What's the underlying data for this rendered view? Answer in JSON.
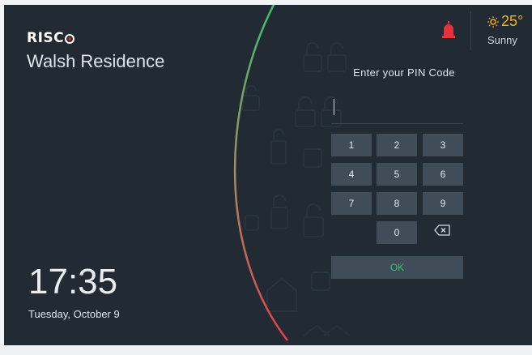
{
  "brand": {
    "logo_text": "RISC"
  },
  "site": {
    "name": "Walsh Residence"
  },
  "clock": {
    "time": "17:35",
    "date": "Tuesday, October 9"
  },
  "weather": {
    "temperature": "25°",
    "condition": "Sunny",
    "icon": "sun-icon",
    "accent": "#f3b323"
  },
  "status": {
    "alarm_icon": "alarm-siren-icon",
    "alarm_color": "#e3343b"
  },
  "pin": {
    "title": "Enter your PIN Code",
    "keys": [
      "1",
      "2",
      "3",
      "4",
      "5",
      "6",
      "7",
      "8",
      "9",
      "0"
    ],
    "ok_label": "OK",
    "ok_color": "#3fbf6f"
  },
  "colors": {
    "background": "#222b33",
    "key": "#404c57",
    "arc_top": "#3fbf6f",
    "arc_bottom": "#e5414a"
  }
}
